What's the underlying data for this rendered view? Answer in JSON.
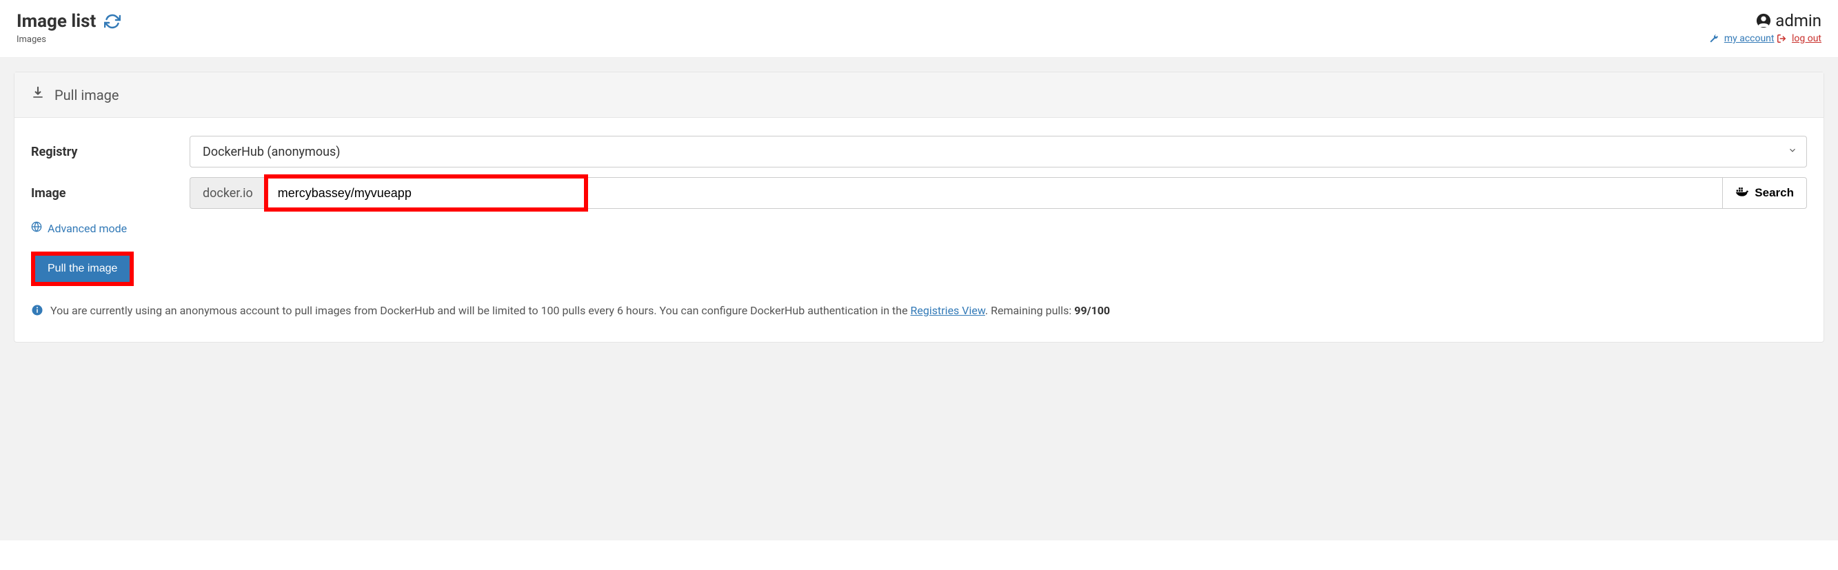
{
  "header": {
    "title": "Image list",
    "breadcrumb": "Images",
    "user_name": "admin",
    "my_account_label": "my account",
    "logout_label": "log out"
  },
  "panel": {
    "title": "Pull image"
  },
  "form": {
    "registry_label": "Registry",
    "registry_value": "DockerHub (anonymous)",
    "image_label": "Image",
    "image_prefix": "docker.io",
    "image_value": "mercybassey/myvueapp",
    "search_label": "Search",
    "advanced_label": "Advanced mode",
    "pull_button_label": "Pull the image"
  },
  "info": {
    "text_pre": "You are currently using an anonymous account to pull images from DockerHub and will be limited to 100 pulls every 6 hours. You can configure DockerHub authentication in the ",
    "link_label": "Registries View",
    "text_post": ". Remaining pulls: ",
    "remaining": "99/100"
  }
}
